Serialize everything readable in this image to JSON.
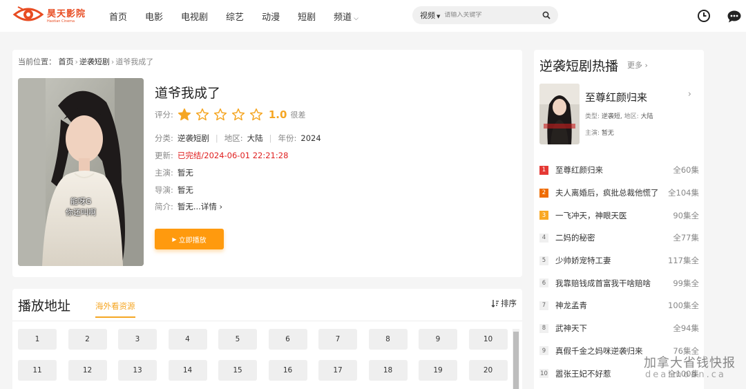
{
  "site": {
    "logo_name": "昊天影院",
    "logo_sub": "Haotian Cinema",
    "brand_color": "#e84c22"
  },
  "nav": [
    {
      "label": "首页"
    },
    {
      "label": "电影"
    },
    {
      "label": "电视剧"
    },
    {
      "label": "综艺"
    },
    {
      "label": "动漫"
    },
    {
      "label": "短剧"
    },
    {
      "label": "频道",
      "has_dropdown": true
    }
  ],
  "search": {
    "type_label": "视频",
    "placeholder": "请输入关键字"
  },
  "header_icons": [
    "history-clock-icon",
    "message-bubble-icon"
  ],
  "breadcrumb": {
    "prefix": "当前位置：",
    "items": [
      "首页",
      "逆袭短剧",
      "道爷我成了"
    ]
  },
  "detail": {
    "title": "道爷我成了",
    "rating_label": "评分:",
    "rating_stars": 1,
    "rating_max": 5,
    "score": "1.0",
    "score_word": "很差",
    "category_label": "分类:",
    "category": "逆袭短剧",
    "region_label": "地区:",
    "region": "大陆",
    "year_label": "年份:",
    "year": "2024",
    "update_label": "更新:",
    "update_value": "已完结/2024-06-01 22:21:28",
    "cast_label": "主演:",
    "cast": "暂无",
    "director_label": "导演:",
    "director": "暂无",
    "intro_label": "简介:",
    "intro": "暂无...",
    "intro_more": "详情",
    "play_button": "立即播放",
    "poster_caption_1": "能呀G",
    "poster_caption_2": "你还叫啊",
    "star_color": "#f5a623"
  },
  "episodes": {
    "title": "播放地址",
    "source_tab": "海外看资源",
    "sort_label": "排序",
    "items": [
      "1",
      "2",
      "3",
      "4",
      "5",
      "6",
      "7",
      "8",
      "9",
      "10",
      "11",
      "12",
      "13",
      "14",
      "15",
      "16",
      "17",
      "18",
      "19",
      "20"
    ]
  },
  "sidebar": {
    "title": "逆袭短剧热播",
    "more_label": "更多",
    "featured": {
      "name": "至尊红颜归来",
      "type_label": "类型:",
      "type_value": "逆袭短,",
      "region_label": "地区:",
      "region_value": "大陆",
      "cast_label": "主演:",
      "cast_value": "暂无"
    },
    "ranks": [
      {
        "num": "1",
        "name": "至尊红颜归来",
        "episodes": "全60集",
        "color": "#e53935"
      },
      {
        "num": "2",
        "name": "夫人离婚后，疯批总裁他慌了",
        "episodes": "全104集",
        "color": "#ef6c00"
      },
      {
        "num": "3",
        "name": "一飞冲天，神眼天医",
        "episodes": "90集全",
        "color": "#f9a825"
      },
      {
        "num": "4",
        "name": "二妈的秘密",
        "episodes": "全77集",
        "color": ""
      },
      {
        "num": "5",
        "name": "少帅娇宠特工妻",
        "episodes": "117集全",
        "color": ""
      },
      {
        "num": "6",
        "name": "我靠赔钱成首富我干啥赔啥",
        "episodes": "99集全",
        "color": ""
      },
      {
        "num": "7",
        "name": "神龙孟青",
        "episodes": "100集全",
        "color": ""
      },
      {
        "num": "8",
        "name": "武神天下",
        "episodes": "全94集",
        "color": ""
      },
      {
        "num": "9",
        "name": "真假千金之妈咪逆袭归来",
        "episodes": "76集全",
        "color": ""
      },
      {
        "num": "10",
        "name": "嚣张王妃不好惹",
        "episodes": "全100集",
        "color": ""
      }
    ]
  },
  "watermark": {
    "line1": "加拿大省钱快报",
    "line2": "dealmoon.ca"
  }
}
